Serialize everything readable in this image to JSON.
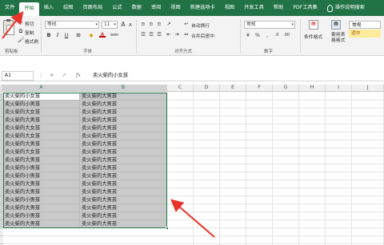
{
  "ribbon_tabs": [
    "文件",
    "开始",
    "插入",
    "绘图",
    "页面布局",
    "公式",
    "数据",
    "审阅",
    "视图",
    "新建选项卡",
    "视图",
    "开发工具",
    "帮助",
    "PDF工具集"
  ],
  "active_tab_index": 1,
  "tell_me": "操作说明搜索",
  "clipboard": {
    "cut": "剪切",
    "copy": "复制",
    "format_painter": "格式刷",
    "group": "剪贴板"
  },
  "font": {
    "name": "等线",
    "size": "11",
    "group": "字体",
    "bold": "B",
    "italic": "I",
    "underline": "U",
    "grow": "A",
    "shrink": "A",
    "color_a": "A",
    "wen": "wén"
  },
  "alignment": {
    "wrap": "自动换行",
    "merge": "合并后居中",
    "group": "对齐方式"
  },
  "number": {
    "format": "常规",
    "percent": "%",
    "comma": ",",
    "group": "数字"
  },
  "styles": {
    "conditional": "条件格式",
    "table_format": "套用表格格式",
    "normal": "常规",
    "neutral": "适中"
  },
  "formula_bar": {
    "name_box": "A1",
    "fx": "fx",
    "cancel": "×",
    "confirm": "✓",
    "value": "卖火柴的小女孩"
  },
  "colors": {
    "brand": "#217346",
    "selection": "#c9c9c9",
    "arrow": "#e8352c",
    "neutral_style": "#ffeb9c"
  },
  "columns": [
    "A",
    "B",
    "C",
    "D",
    "E",
    "F",
    "G",
    "H",
    "I",
    "J"
  ],
  "selected_columns": [
    "A",
    "B"
  ],
  "rows": [
    [
      "卖火柴的小女孩",
      "卖火柴的大男孩"
    ],
    [
      "卖火柴的小男孩",
      "卖火柴的大男孩"
    ],
    [
      "卖火柴的大女孩",
      "卖火柴的大男孩"
    ],
    [
      "卖火柴的大男孩",
      "卖火柴的大男孩"
    ],
    [
      "卖火柴的大女孩",
      "卖火柴的大男孩"
    ],
    [
      "卖火柴的大女孩",
      "卖火柴的大男孩"
    ],
    [
      "卖火柴的大男孩",
      "卖火柴的大男孩"
    ],
    [
      "卖火柴的大女孩",
      "卖火柴的大男孩"
    ],
    [
      "卖火柴的大男孩",
      "卖火柴的大男孩"
    ],
    [
      "卖火柴的小男孩",
      "卖火柴的大男孩"
    ],
    [
      "卖火柴的小男孩",
      "卖火柴的大男孩"
    ],
    [
      "卖火柴的大男孩",
      "卖火柴的大男孩"
    ],
    [
      "卖火柴的大男孩",
      "卖火柴的大男孩"
    ],
    [
      "卖火柴的小男孩",
      "卖火柴的大男孩"
    ],
    [
      "卖火柴的大男孩",
      "卖火柴的大男孩"
    ],
    [
      "卖火柴的小男孩",
      "卖火柴的大男孩"
    ],
    [
      "卖火柴的大男孩",
      "卖火柴的大男孩"
    ]
  ]
}
